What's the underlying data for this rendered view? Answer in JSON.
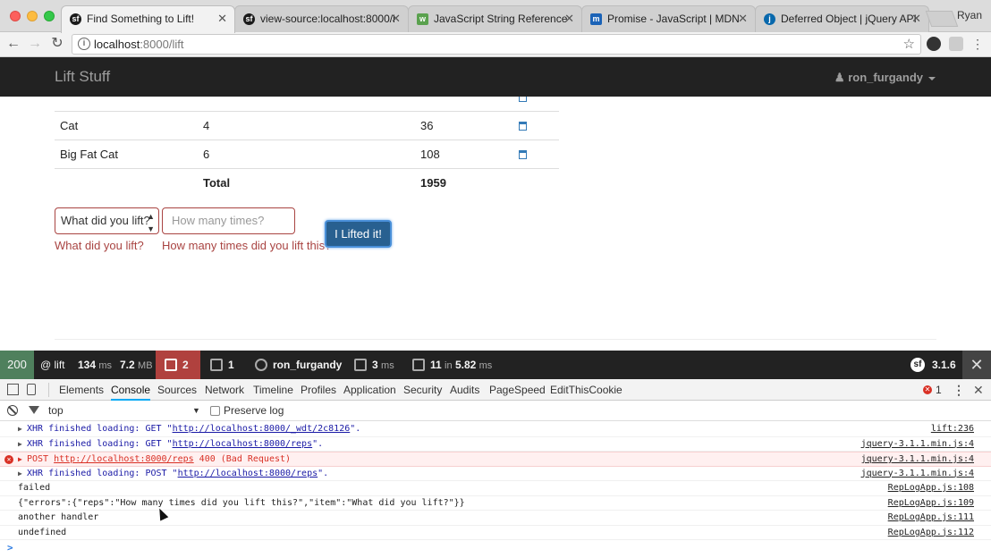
{
  "browser": {
    "tabs": [
      {
        "title": "Find Something to Lift!",
        "active": true,
        "icon": "symfony-icon"
      },
      {
        "title": "view-source:localhost:8000/l",
        "active": false,
        "icon": "symfony-icon"
      },
      {
        "title": "JavaScript String Reference",
        "active": false,
        "icon": "w3schools-icon"
      },
      {
        "title": "Promise - JavaScript | MDN",
        "active": false,
        "icon": "mdn-icon"
      },
      {
        "title": "Deferred Object | jQuery API",
        "active": false,
        "icon": "jquery-icon"
      }
    ],
    "profile": "Ryan",
    "url_host": "localhost",
    "url_path": ":8000/lift"
  },
  "navbar": {
    "brand": "Lift Stuff",
    "user": "ron_furgandy"
  },
  "table": {
    "rows": [
      {
        "item": "Cat",
        "reps": "4",
        "weight": "36"
      },
      {
        "item": "Big Fat Cat",
        "reps": "6",
        "weight": "108"
      }
    ],
    "total_label": "Total",
    "total_value": "1959"
  },
  "form": {
    "select_value": "What did you lift?",
    "reps_placeholder": "How many times?",
    "item_error": "What did you lift?",
    "reps_error": "How many times did you lift this?",
    "submit_label": "I Lifted it!"
  },
  "symfony": {
    "status": "200",
    "route": "@ lift",
    "time_value": "134",
    "time_unit": "ms",
    "memory_value": "7.2",
    "memory_unit": "MB",
    "ajax_count": "2",
    "requests_count": "1",
    "user": "ron_furgandy",
    "twig_value": "3",
    "twig_unit": "ms",
    "db_count": "11",
    "db_in": "in",
    "db_time": "5.82",
    "db_unit": "ms",
    "version": "3.1.6"
  },
  "devtools": {
    "tabs": [
      "Elements",
      "Console",
      "Sources",
      "Network",
      "Timeline",
      "Profiles",
      "Application",
      "Security",
      "Audits",
      "PageSpeed",
      "EditThisCookie"
    ],
    "active_tab": "Console",
    "error_count": "1",
    "context": "top",
    "preserve_log": "Preserve log"
  },
  "console": {
    "logs": [
      {
        "type": "xhr",
        "pre": "XHR finished loading: GET \"",
        "url": "http://localhost:8000/_wdt/2c8126",
        "post": "\".",
        "source": "lift:236"
      },
      {
        "type": "xhr",
        "pre": "XHR finished loading: GET \"",
        "url": "http://localhost:8000/reps",
        "post": "\".",
        "source": "jquery-3.1.1.min.js:4"
      },
      {
        "type": "error",
        "pre": "POST ",
        "url": "http://localhost:8000/reps",
        "post": " 400 (Bad Request)",
        "source": "jquery-3.1.1.min.js:4"
      },
      {
        "type": "xhr",
        "pre": "XHR finished loading: POST \"",
        "url": "http://localhost:8000/reps",
        "post": "\".",
        "source": "jquery-3.1.1.min.js:4"
      },
      {
        "type": "log",
        "text": "failed",
        "source": "RepLogApp.js:108"
      },
      {
        "type": "log",
        "text": "{\"errors\":{\"reps\":\"How many times did you lift this?\",\"item\":\"What did you lift?\"}}",
        "source": "RepLogApp.js:109"
      },
      {
        "type": "log",
        "text": "another handler",
        "source": "RepLogApp.js:111"
      },
      {
        "type": "log",
        "text": "undefined",
        "source": "RepLogApp.js:112"
      }
    ]
  },
  "colors": {
    "navbar_bg": "#222222",
    "error_text": "#a94442",
    "primary_button": "#286090",
    "sf_status_ok": "#4f805d",
    "sf_ajax": "#b0413e"
  }
}
